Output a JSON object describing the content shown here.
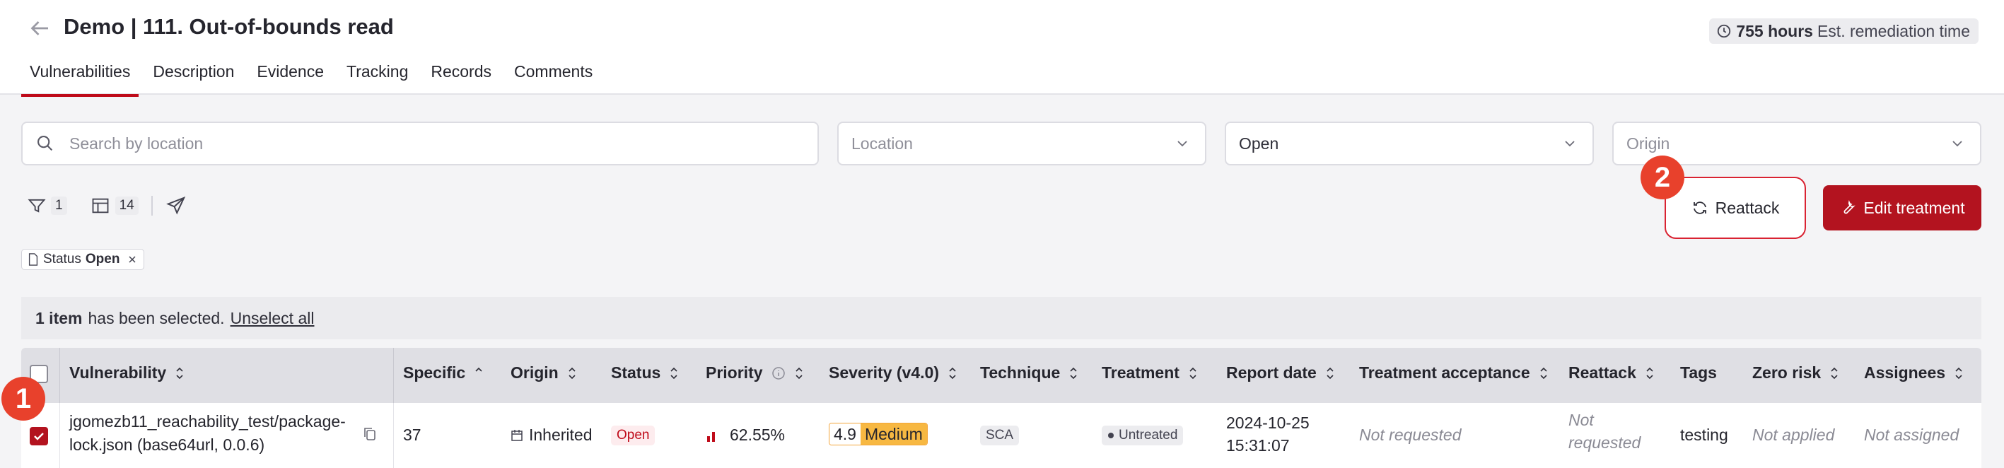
{
  "header": {
    "title": "Demo | 111. Out-of-bounds read",
    "remediation_hours": "755 hours",
    "remediation_label": "Est. remediation time"
  },
  "tabs": [
    {
      "label": "Vulnerabilities",
      "active": true
    },
    {
      "label": "Description"
    },
    {
      "label": "Evidence"
    },
    {
      "label": "Tracking"
    },
    {
      "label": "Records"
    },
    {
      "label": "Comments"
    }
  ],
  "filters": {
    "search_placeholder": "Search by location",
    "location_placeholder": "Location",
    "status_value": "Open",
    "origin_placeholder": "Origin"
  },
  "toolbar": {
    "filter_count": "1",
    "columns_count": "14"
  },
  "actions": {
    "reattack_label": "Reattack",
    "edit_treatment_label": "Edit treatment"
  },
  "markers": {
    "one": "1",
    "two": "2"
  },
  "active_filter": {
    "name": "Status",
    "value": "Open"
  },
  "selection": {
    "count": "1 item",
    "text": "has been selected.",
    "unselect": "Unselect all"
  },
  "table": {
    "columns": [
      "Vulnerability",
      "Specific",
      "Origin",
      "Status",
      "Priority",
      "Severity (v4.0)",
      "Technique",
      "Treatment",
      "Report date",
      "Treatment acceptance",
      "Reattack",
      "Tags",
      "Zero risk",
      "Assignees"
    ],
    "rows": [
      {
        "vulnerability_line1": "jgomezb11_reachability_test/package-",
        "vulnerability_line2": "lock.json (base64url, 0.0.6)",
        "specific": "37",
        "origin": "Inherited",
        "status": "Open",
        "priority": "62.55%",
        "severity_score": "4.9",
        "severity_label": "Medium",
        "technique": "SCA",
        "treatment": "Untreated",
        "report_date_line1": "2024-10-25",
        "report_date_line2": "15:31:07",
        "treatment_acceptance": "Not requested",
        "reattack_line1": "Not",
        "reattack_line2": "requested",
        "tags": "testing",
        "zero_risk": "Not applied",
        "assignees": "Not assigned"
      }
    ]
  },
  "colors": {
    "accent": "#b3131f",
    "marker": "#e8412c",
    "medium": "#f7b842"
  }
}
